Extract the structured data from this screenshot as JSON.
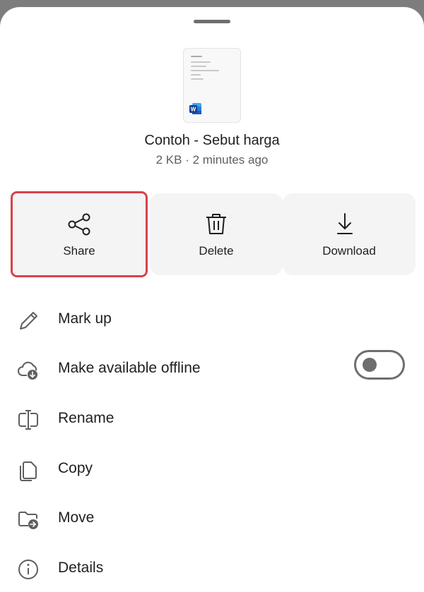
{
  "file": {
    "name": "Contoh - Sebut harga",
    "meta": "2 KB · 2 minutes ago",
    "thumbnail_icon": "word-doc-icon"
  },
  "actions": [
    {
      "label": "Share",
      "icon": "share-icon",
      "selected": true
    },
    {
      "label": "Delete",
      "icon": "trash-icon",
      "selected": false
    },
    {
      "label": "Download",
      "icon": "download-icon",
      "selected": false
    }
  ],
  "menu": [
    {
      "label": "Mark up",
      "icon": "pencil-icon"
    },
    {
      "label": "Make available offline",
      "icon": "cloud-download-icon",
      "toggle": false
    },
    {
      "label": "Rename",
      "icon": "rename-icon"
    },
    {
      "label": "Copy",
      "icon": "copy-icon"
    },
    {
      "label": "Move",
      "icon": "move-folder-icon"
    },
    {
      "label": "Details",
      "icon": "info-icon"
    }
  ],
  "colors": {
    "selection_outline": "#d9414b",
    "tile_background": "#f4f4f4",
    "word_blue": "#185abd"
  }
}
